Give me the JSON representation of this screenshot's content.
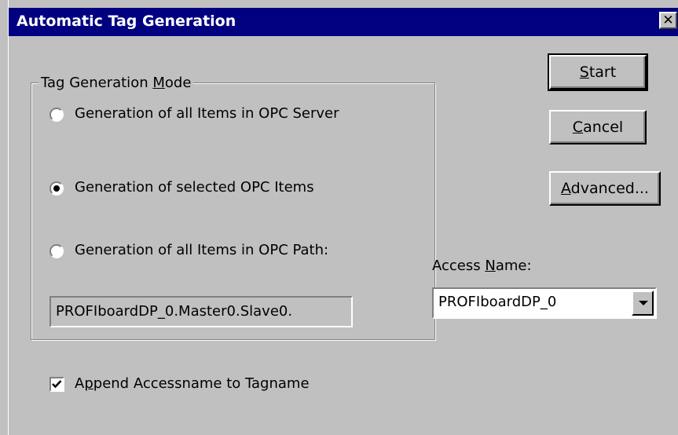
{
  "window": {
    "title": "Automatic Tag Generation",
    "close_glyph": "✕"
  },
  "buttons": {
    "start": {
      "pre": "",
      "u": "S",
      "post": "tart"
    },
    "cancel": {
      "pre": "",
      "u": "C",
      "post": "ancel"
    },
    "advanced": {
      "pre": "",
      "u": "A",
      "post": "dvanced..."
    }
  },
  "mode_group": {
    "label_pre": "Tag Generation ",
    "label_u": "M",
    "label_post": "ode",
    "options": [
      {
        "label": "Generation of all Items in OPC Server",
        "selected": false
      },
      {
        "label": "Generation of selected OPC Items",
        "selected": true
      },
      {
        "label": "Generation of all Items in OPC Path:",
        "selected": false
      }
    ],
    "path_value": "PROFIboardDP_0.Master0.Slave0."
  },
  "access_name": {
    "label_pre": "Access ",
    "label_u": "N",
    "label_post": "ame:",
    "value": "PROFIboardDP_0"
  },
  "append_option": {
    "label_pre": "A",
    "label_u": "p",
    "label_post": "pend Accessname to Tagname",
    "checked": true
  },
  "colors": {
    "titlebar": "#000080",
    "face": "#c0c0c0"
  }
}
